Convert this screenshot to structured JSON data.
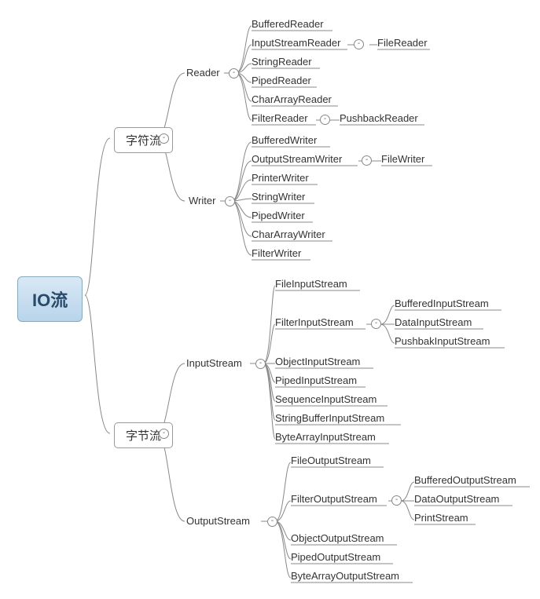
{
  "root": "IO流",
  "charStream": "字符流",
  "byteStream": "字节流",
  "reader": "Reader",
  "writer": "Writer",
  "inputStream": "InputStream",
  "outputStream": "OutputStream",
  "r": {
    "buffered": "BufferedReader",
    "isr": "InputStreamReader",
    "string": "StringReader",
    "piped": "PipedReader",
    "chararr": "CharArrayReader",
    "filter": "FilterReader",
    "file": "FileReader",
    "pushback": "PushbackReader"
  },
  "w": {
    "buffered": "BufferedWriter",
    "osw": "OutputStreamWriter",
    "printer": "PrinterWriter",
    "string": "StringWriter",
    "piped": "PipedWriter",
    "chararr": "CharArrayWriter",
    "filter": "FilterWriter",
    "file": "FileWriter"
  },
  "is": {
    "file": "FileInputStream",
    "filter": "FilterInputStream",
    "object": "ObjectInputStream",
    "piped": "PipedInputStream",
    "seq": "SequenceInputStream",
    "strbuf": "StringBufferInputStream",
    "bytearr": "ByteArrayInputStream",
    "buffered": "BufferedInputStream",
    "data": "DataInputStream",
    "pushback": "PushbakInputStream"
  },
  "os": {
    "file": "FileOutputStream",
    "filter": "FilterOutputStream",
    "object": "ObjectOutputStream",
    "piped": "PipedOutputStream",
    "bytearr": "ByteArrayOutputStream",
    "buffered": "BufferedOutputStream",
    "data": "DataOutputStream",
    "print": "PrintStream"
  }
}
